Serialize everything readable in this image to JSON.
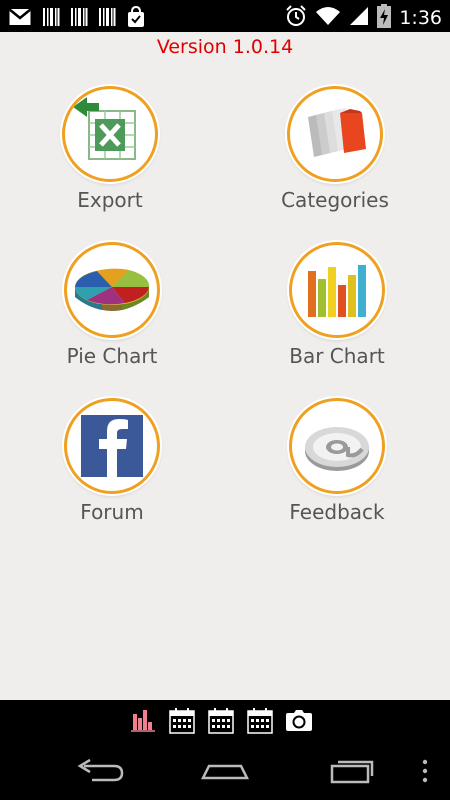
{
  "status_bar": {
    "time": "1:36",
    "notification_icons": [
      "gmail-icon",
      "barcode-icon",
      "barcode-icon",
      "barcode-icon",
      "shopping-bag-icon"
    ],
    "system_icons": [
      "alarm-icon",
      "wifi-icon",
      "signal-icon",
      "battery-charging-icon"
    ]
  },
  "app": {
    "version": "Version 1.0.14"
  },
  "menu": {
    "items": [
      {
        "label": "Export",
        "icon": "excel-export-icon"
      },
      {
        "label": "Categories",
        "icon": "folders-icon"
      },
      {
        "label": "Pie Chart",
        "icon": "pie-chart-icon"
      },
      {
        "label": "Bar Chart",
        "icon": "bar-chart-icon"
      },
      {
        "label": "Forum",
        "icon": "facebook-icon"
      },
      {
        "label": "Feedback",
        "icon": "at-sign-icon"
      }
    ]
  },
  "toolbar": {
    "icons": [
      "bar-chart-small-icon",
      "calendar-icon",
      "calendar-icon",
      "calendar-icon",
      "camera-icon"
    ]
  },
  "navigation": {
    "buttons": [
      "back-icon",
      "home-icon",
      "recent-apps-icon",
      "more-options-icon"
    ]
  },
  "colors": {
    "version_text": "#e00000",
    "ring": "#f0a020",
    "background": "#efeeed",
    "label": "#555555"
  }
}
